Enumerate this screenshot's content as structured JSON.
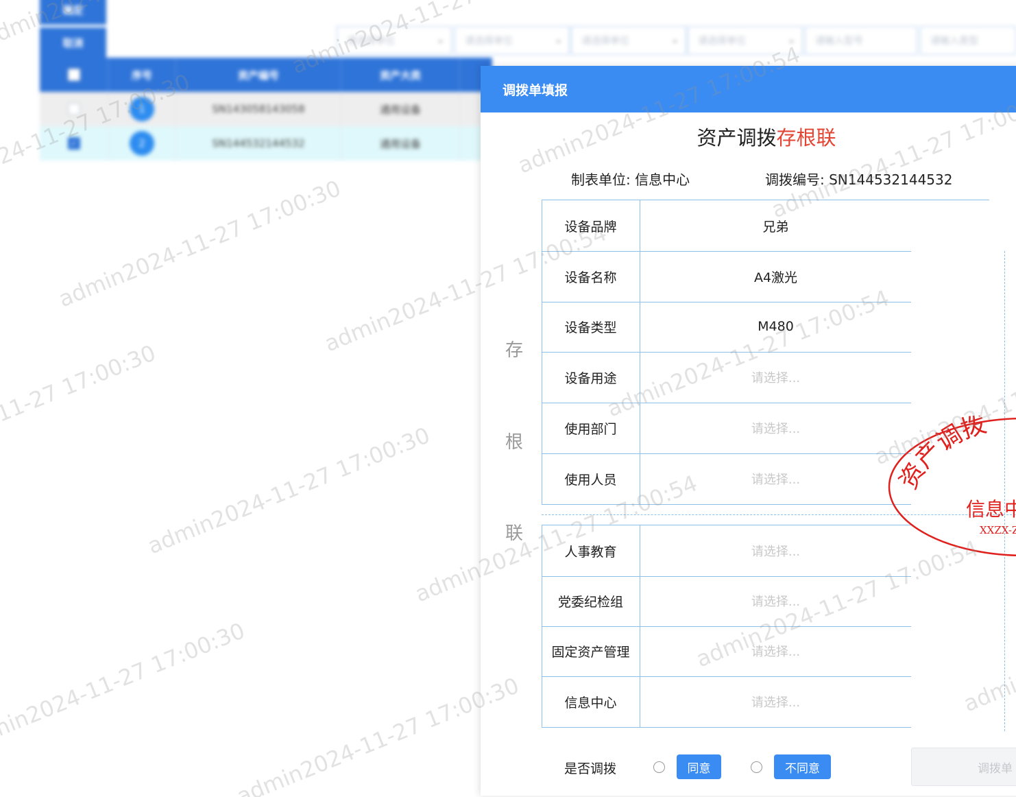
{
  "background": {
    "buttons": [
      "确定",
      "取消"
    ],
    "filters": [
      "请选择单位",
      "请选择单位",
      "请选择单位",
      "请选择单位",
      "请输入型号",
      "请输入类型"
    ],
    "table": {
      "headers": [
        "",
        "序号",
        "资产编号",
        "资产大类"
      ],
      "rows": [
        {
          "checked": false,
          "index": "1",
          "asset_no": "SN143058143058",
          "category": "通用设备"
        },
        {
          "checked": true,
          "index": "2",
          "asset_no": "SN144532144532",
          "category": "通用设备"
        }
      ]
    }
  },
  "watermark": {
    "texts": [
      "admin2024-11-27 17:00:30",
      "admin2024-11-27 17:00:54"
    ]
  },
  "modal": {
    "title": "调拨单填报",
    "form_title_main": "资产调拨",
    "form_title_red": "存根联",
    "unit_label": "制表单位:",
    "unit_value": "信息中心",
    "code_label": "调拨编号:",
    "code_value": "SN144532144532",
    "side_chars": [
      "存",
      "根",
      "联"
    ],
    "fields": [
      {
        "label": "设备品牌",
        "value": "兄弟",
        "placeholder": false
      },
      {
        "label": "设备名称",
        "value": "A4激光",
        "placeholder": false
      },
      {
        "label": "设备类型",
        "value": "M480",
        "placeholder": false
      },
      {
        "label": "设备用途",
        "value": "请选择...",
        "placeholder": true
      },
      {
        "label": "使用部门",
        "value": "请选择...",
        "placeholder": true
      },
      {
        "label": "使用人员",
        "value": "请选择...",
        "placeholder": true
      }
    ],
    "approvals": [
      {
        "label": "人事教育",
        "value": "请选择..."
      },
      {
        "label": "党委纪检组",
        "value": "请选择..."
      },
      {
        "label": "固定资产管理",
        "value": "请选择..."
      },
      {
        "label": "信息中心",
        "value": "请选择..."
      }
    ],
    "stamp": {
      "top_text": "资产调拨",
      "center_text": "信息中",
      "code_text": "XXZX-Z",
      "color": "#e0201c"
    },
    "transfer_label": "是否调拨",
    "agree_label": "同意",
    "disagree_label": "不同意",
    "submit_label": "调拨单"
  },
  "colors": {
    "primary": "#3a8bf2",
    "accent_red": "#e44433",
    "table_border": "#8cc0e8"
  }
}
